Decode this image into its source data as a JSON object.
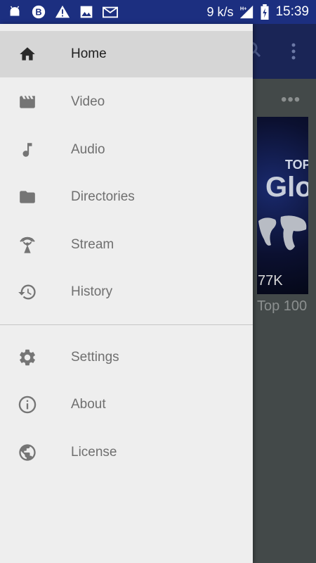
{
  "status_bar": {
    "speed": "9 k/s",
    "network": "H+",
    "time": "15:39",
    "icons": [
      "android-icon",
      "b-icon",
      "warning-icon",
      "image-icon",
      "mail-icon",
      "signal-icon",
      "battery-charging-icon"
    ]
  },
  "drawer": {
    "main_items": [
      {
        "label": "Home",
        "icon": "home-icon",
        "selected": true
      },
      {
        "label": "Video",
        "icon": "video-icon"
      },
      {
        "label": "Audio",
        "icon": "music-note-icon"
      },
      {
        "label": "Directories",
        "icon": "folder-icon"
      },
      {
        "label": "Stream",
        "icon": "stream-icon"
      },
      {
        "label": "History",
        "icon": "history-icon"
      }
    ],
    "secondary_items": [
      {
        "label": "Settings",
        "icon": "gear-icon"
      },
      {
        "label": "About",
        "icon": "info-icon"
      },
      {
        "label": "License",
        "icon": "globe-icon"
      }
    ]
  },
  "background": {
    "thumb_text_top": "TOP",
    "thumb_text_main": "Glo",
    "views": "77K",
    "item_title": "Top 100"
  },
  "colors": {
    "status_bar": "#1c2f80",
    "drawer_bg": "#eeeeee",
    "selected_bg": "#d6d6d6",
    "scrim": "#444a4b"
  }
}
